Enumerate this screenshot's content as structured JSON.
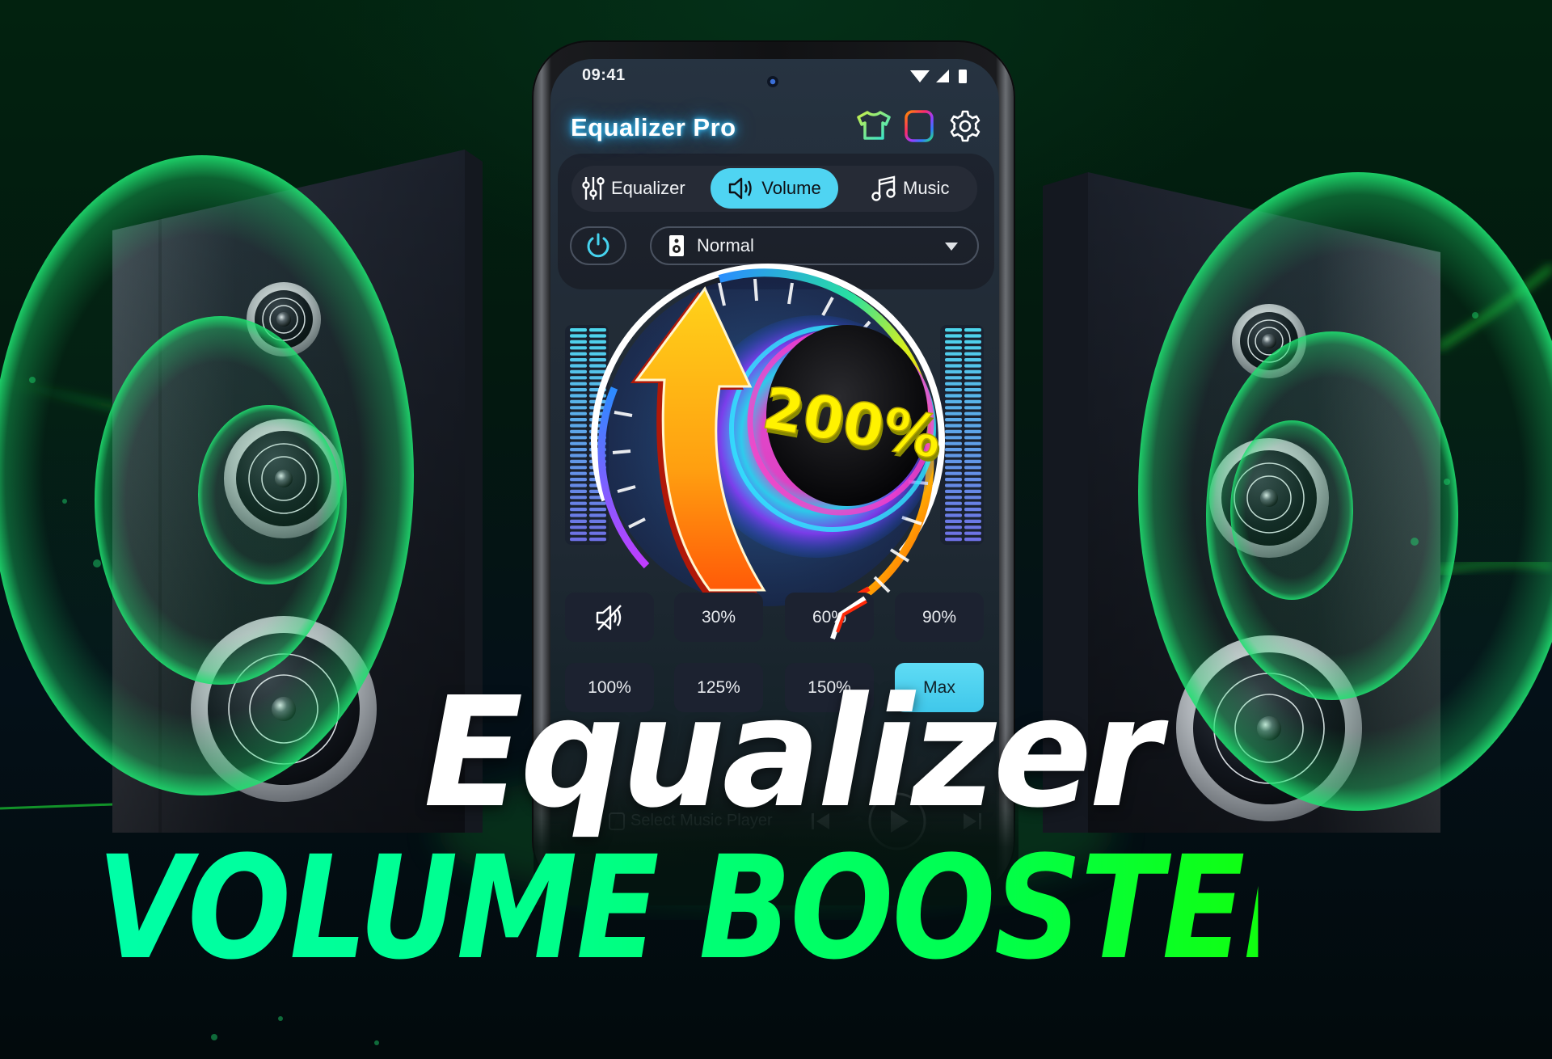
{
  "status_bar": {
    "time": "09:41",
    "icons": [
      "wifi-icon",
      "cell-signal-icon",
      "battery-icon"
    ]
  },
  "app": {
    "title": "Equalizer Pro",
    "header_icons": [
      "theme-shirt-icon",
      "rgb-border-icon",
      "settings-gear-icon"
    ]
  },
  "tabs": [
    {
      "label": "Equalizer",
      "icon": "sliders-icon",
      "active": false
    },
    {
      "label": "Volume",
      "icon": "speaker-icon",
      "active": true
    },
    {
      "label": "Music",
      "icon": "music-note-icon",
      "active": false
    }
  ],
  "preset": {
    "power": "on",
    "selected": "Normal",
    "icon": "speaker-box-icon"
  },
  "gauge": {
    "boost_label": "200%",
    "boost_percent": 200
  },
  "volume_presets": [
    {
      "label": "",
      "icon": "mute-icon",
      "kind": "mute"
    },
    {
      "label": "30%"
    },
    {
      "label": "60%"
    },
    {
      "label": "90%"
    },
    {
      "label": "100%"
    },
    {
      "label": "125%"
    },
    {
      "label": "150%"
    },
    {
      "label": "Max",
      "active": true
    }
  ],
  "player": {
    "label": "Select Music Player"
  },
  "headline": {
    "line1": "Equalizer",
    "line2": "VOLUME BOOSTER"
  },
  "colors": {
    "accent": "#4fd4f2",
    "headline_green_start": "#00ffa8",
    "headline_green_end": "#10ff10",
    "glow_green": "#1fe070",
    "boost_yellow": "#ffe600"
  }
}
